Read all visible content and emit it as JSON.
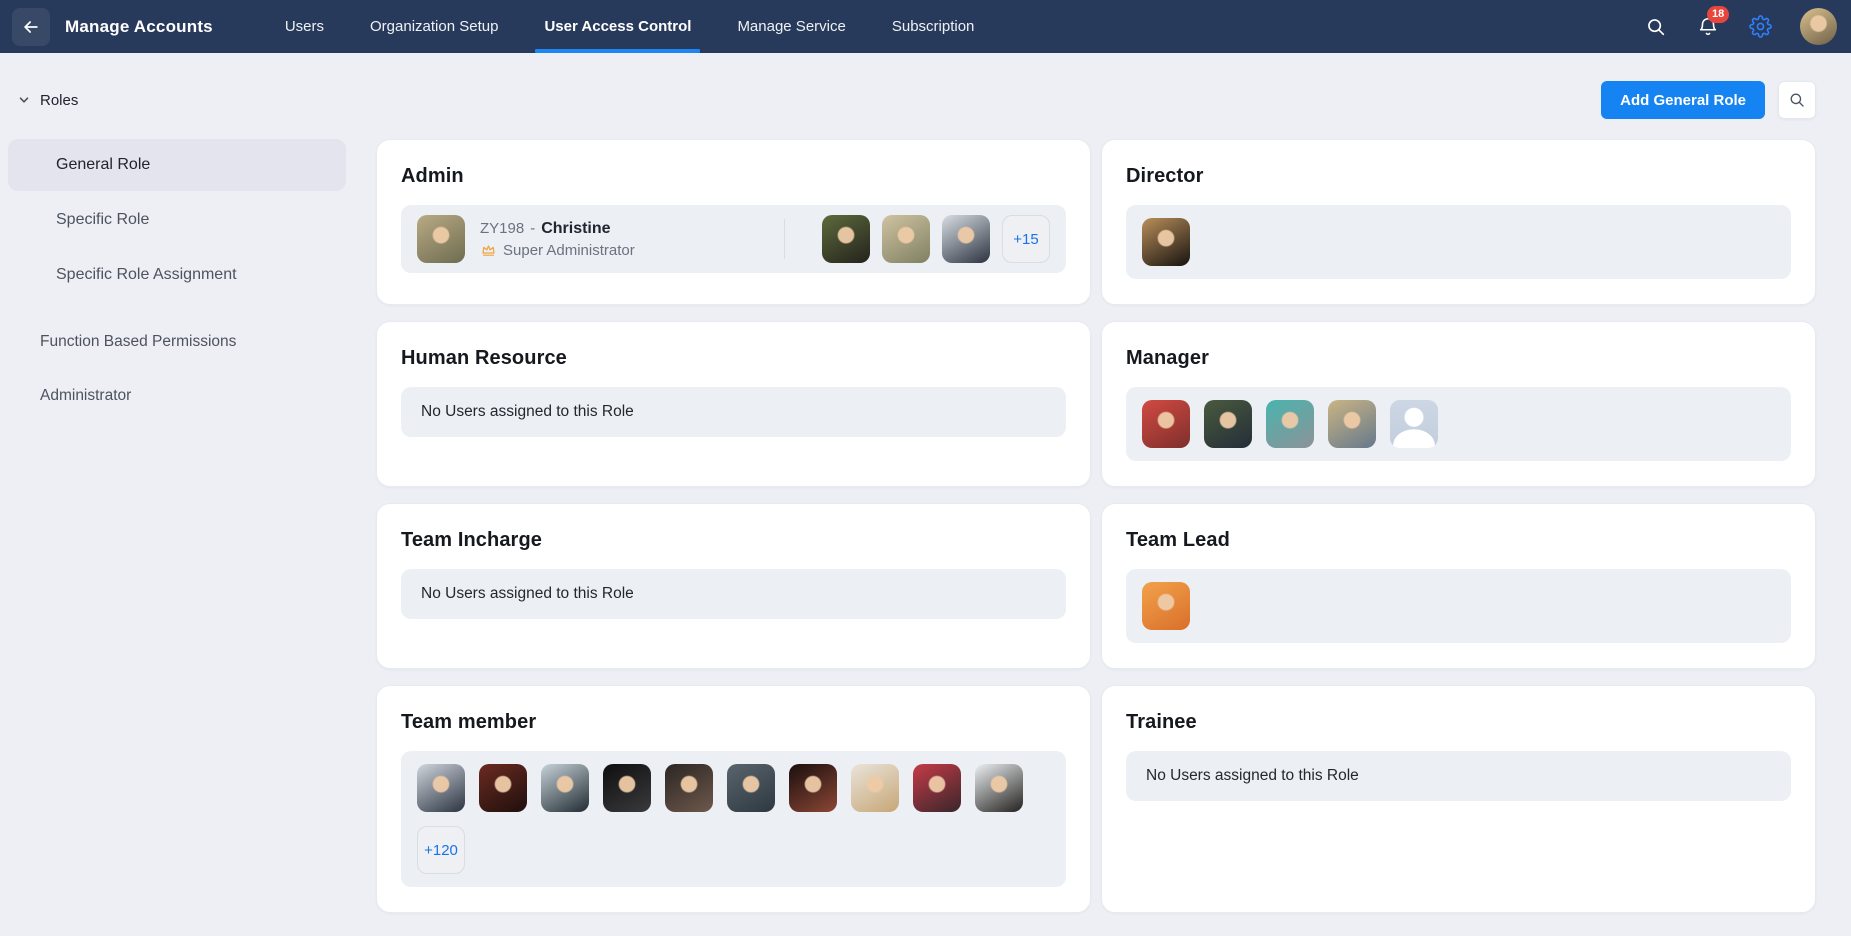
{
  "colors": {
    "topbar_bg": "#283a5b",
    "page_bg": "#edeff5",
    "panel_bg": "#eceff4",
    "selected_bg": "#e4e4ee",
    "accent_blue": "#1583f2",
    "tab_underline": "#1e86f0",
    "badge_red": "#e8453c",
    "chip_blue": "#1a73e8",
    "gear_blue": "#2f7ff7"
  },
  "topbar": {
    "title": "Manage Accounts",
    "back_icon": "arrow-left-icon",
    "tabs": [
      {
        "label": "Users",
        "active": false
      },
      {
        "label": "Organization Setup",
        "active": false
      },
      {
        "label": "User Access Control",
        "active": true
      },
      {
        "label": "Manage Service",
        "active": false
      },
      {
        "label": "Subscription",
        "active": false
      }
    ],
    "icons": [
      "search-icon",
      "bell-icon",
      "gear-icon"
    ],
    "notification_count": "18",
    "avatar": {
      "type": "photo",
      "c1": "#d9c08e",
      "c2": "#6f6148"
    }
  },
  "toolbar": {
    "add_button_label": "Add General Role",
    "search_icon": "search-icon"
  },
  "sidebar": {
    "section_label": "Roles",
    "items": [
      {
        "label": "General Role",
        "selected": true
      },
      {
        "label": "Specific Role",
        "selected": false
      },
      {
        "label": "Specific Role Assignment",
        "selected": false
      }
    ],
    "links": [
      {
        "label": "Function Based Permissions"
      },
      {
        "label": "Administrator"
      }
    ]
  },
  "roles": [
    {
      "title": "Admin",
      "primary_user": {
        "id": "ZY198",
        "separator": "-",
        "name": "Christine",
        "role": "Super Administrator",
        "crown_icon": "crown-icon",
        "avatar": {
          "type": "photo",
          "c1": "#b9aa85",
          "c2": "#6e6c50"
        }
      },
      "group_avatars": [
        {
          "type": "photo",
          "c1": "#5c6b3c",
          "c2": "#25221c"
        },
        {
          "type": "photo",
          "c1": "#cfc3a2",
          "c2": "#7f8062"
        },
        {
          "type": "photo",
          "c1": "#d9dee3",
          "c2": "#2c3340"
        }
      ],
      "overflow_label": "+15"
    },
    {
      "title": "Director",
      "avatars": [
        {
          "type": "photo",
          "c1": "#b98f5a",
          "c2": "#171310"
        }
      ]
    },
    {
      "title": "Human Resource",
      "empty_text": "No Users assigned to this Role"
    },
    {
      "title": "Manager",
      "avatars": [
        {
          "type": "photo",
          "c1": "#d24a42",
          "c2": "#7e2f2c"
        },
        {
          "type": "photo",
          "c1": "#4a5a3e",
          "c2": "#232e38"
        },
        {
          "type": "photo",
          "c1": "#49b4ae",
          "c2": "#8c9298"
        },
        {
          "type": "photo",
          "c1": "#c9b583",
          "c2": "#66788c"
        },
        {
          "type": "placeholder",
          "c1": "#ccd6e4",
          "c2": "#c3cedd"
        }
      ]
    },
    {
      "title": "Team Incharge",
      "empty_text": "No Users assigned to this Role"
    },
    {
      "title": "Team Lead",
      "avatars": [
        {
          "type": "photo",
          "c1": "#f2a24b",
          "c2": "#d96f2a"
        }
      ]
    },
    {
      "title": "Team member",
      "avatars": [
        {
          "type": "photo",
          "c1": "#cfd6dd",
          "c2": "#2c3441"
        },
        {
          "type": "photo",
          "c1": "#6b2a22",
          "c2": "#1f0f0c"
        },
        {
          "type": "photo",
          "c1": "#c6d3d8",
          "c2": "#212b33"
        },
        {
          "type": "photo",
          "c1": "#0f0f10",
          "c2": "#3a3a3c"
        },
        {
          "type": "photo",
          "c1": "#2b2624",
          "c2": "#6e584b"
        },
        {
          "type": "photo",
          "c1": "#59646e",
          "c2": "#2e3840"
        },
        {
          "type": "photo",
          "c1": "#1a0f0d",
          "c2": "#8c4636"
        },
        {
          "type": "photo",
          "c1": "#e9e4da",
          "c2": "#c7a676"
        },
        {
          "type": "photo",
          "c1": "#c63b49",
          "c2": "#38262a"
        },
        {
          "type": "photo",
          "c1": "#eceff1",
          "c2": "#23211f"
        }
      ],
      "overflow_label": "+120"
    },
    {
      "title": "Trainee",
      "empty_text": "No Users assigned to this Role"
    }
  ]
}
